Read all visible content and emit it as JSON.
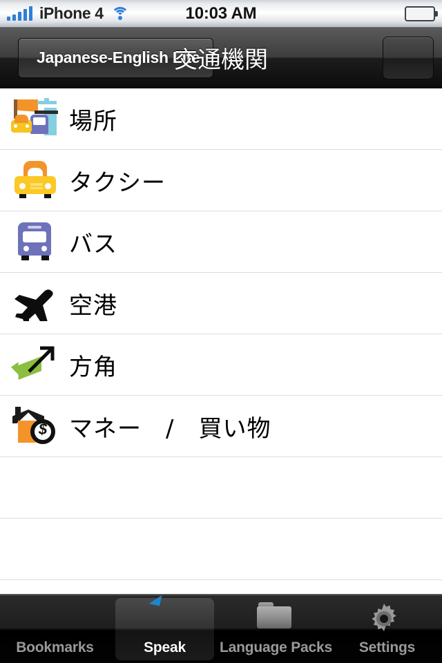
{
  "status_bar": {
    "carrier": "iPhone 4",
    "time": "10:03 AM",
    "signal_icon": "signal-bars-icon",
    "wifi_icon": "wifi-icon",
    "battery_icon": "battery-full-icon",
    "signal_color": "#2f7fd6",
    "battery_color": "#49b814"
  },
  "nav_bar": {
    "back_label": "Japanese-English Lite",
    "title": "交通機関",
    "right_button_icon": "bookmark-ribbon-icon"
  },
  "list": {
    "rows": [
      {
        "label": "場所",
        "icon": "places-icon"
      },
      {
        "label": "タクシー",
        "icon": "taxi-icon"
      },
      {
        "label": "バス",
        "icon": "bus-icon"
      },
      {
        "label": "空港",
        "icon": "airplane-icon"
      },
      {
        "label": "方角",
        "icon": "directions-arrow-icon"
      },
      {
        "label": "マネー　/　買い物",
        "icon": "money-shopping-icon"
      }
    ],
    "empty_row_count": 3
  },
  "tab_bar": {
    "tabs": [
      {
        "label": "Bookmarks",
        "icon": "bookmark-ribbon-icon",
        "selected": false
      },
      {
        "label": "Speak",
        "icon": "speech-bubble-icon",
        "selected": true
      },
      {
        "label": "Language Packs",
        "icon": "folder-icon",
        "selected": false
      },
      {
        "label": "Settings",
        "icon": "gear-icon",
        "selected": false
      }
    ],
    "selected_label_color": "#ffffff",
    "label_color": "#9a9a9a"
  }
}
